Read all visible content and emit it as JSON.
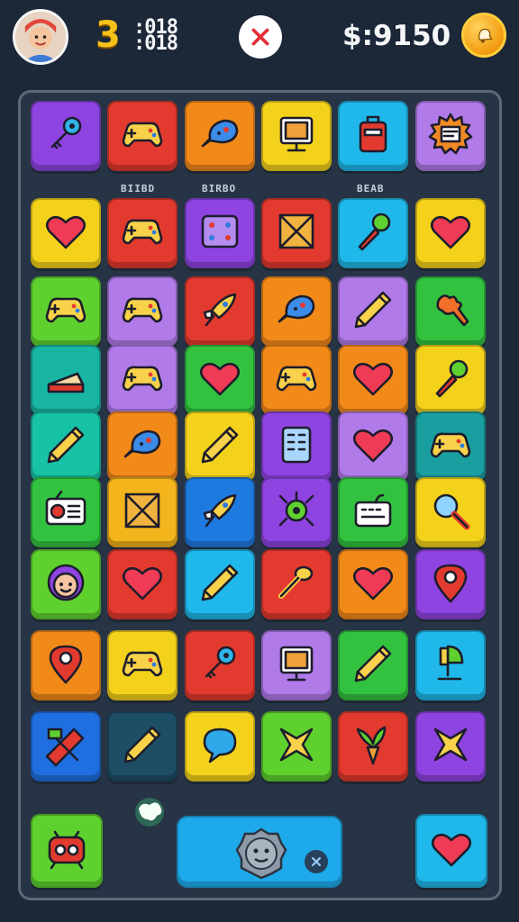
{
  "hud": {
    "level": "3",
    "score": ":018\n:018",
    "score_line1": ":018",
    "score_line2": ":018",
    "coins": "$:9150",
    "close_icon": "close-x-icon",
    "coin_icon": "coin-bell-icon"
  },
  "board": {
    "labels": [
      "BIIBD",
      "BIRBO",
      "BEAB"
    ],
    "rows": [
      [
        {
          "icon": "key-icon",
          "color": "#8e44e0"
        },
        {
          "icon": "gamepad-icon",
          "color": "#e33a2f"
        },
        {
          "icon": "fish-icon",
          "color": "#f28a1a"
        },
        {
          "icon": "monitor-icon",
          "color": "#f4d21c"
        },
        {
          "icon": "luggage-icon",
          "color": "#20b8ea"
        },
        {
          "icon": "sun-card-icon",
          "color": "#b07ae8"
        }
      ],
      [
        {
          "icon": "heart-icon",
          "color": "#f4d21c"
        },
        {
          "icon": "gamepad-icon",
          "color": "#e33a2f"
        },
        {
          "icon": "dice-icon",
          "color": "#8e44e0"
        },
        {
          "icon": "crate-icon",
          "color": "#e33a2f"
        },
        {
          "icon": "microphone-icon",
          "color": "#20b8ea"
        },
        {
          "icon": "heart-icon",
          "color": "#f4d21c"
        }
      ],
      [
        {
          "icon": "gamepad-icon",
          "color": "#5fd12f"
        },
        {
          "icon": "gamepad-icon",
          "color": "#b07ae8"
        },
        {
          "icon": "rocket-icon",
          "color": "#e33a2f"
        },
        {
          "icon": "fish-icon",
          "color": "#f28a1a"
        },
        {
          "icon": "pencil-icon",
          "color": "#b07ae8"
        },
        {
          "icon": "paint-splat-icon",
          "color": "#33c240"
        }
      ],
      [
        {
          "icon": "cake-slice-icon",
          "color": "#18b5a3"
        },
        {
          "icon": "gamepad-icon",
          "color": "#b07ae8"
        },
        {
          "icon": "heart-icon",
          "color": "#33c240"
        },
        {
          "icon": "gamepad-icon",
          "color": "#f28a1a"
        },
        {
          "icon": "heart-icon",
          "color": "#f28a1a"
        },
        {
          "icon": "microphone-icon",
          "color": "#f4d21c"
        }
      ],
      [
        {
          "icon": "pencil-icon",
          "color": "#18c3a5"
        },
        {
          "icon": "fish-icon",
          "color": "#f28a1a"
        },
        {
          "icon": "pencil-icon",
          "color": "#f4d21c"
        },
        {
          "icon": "calculator-icon",
          "color": "#8e44e0"
        },
        {
          "icon": "heart-icon",
          "color": "#b07ae8"
        },
        {
          "icon": "gamepad-icon",
          "color": "#1a9fa0"
        }
      ],
      [
        {
          "icon": "radio-icon",
          "color": "#33c240"
        },
        {
          "icon": "crate-icon",
          "color": "#f4b41c"
        },
        {
          "icon": "rocket-icon",
          "color": "#1f7ae0"
        },
        {
          "icon": "bug-icon",
          "color": "#8e44e0"
        },
        {
          "icon": "keyboard-icon",
          "color": "#33c240"
        },
        {
          "icon": "magnifier-icon",
          "color": "#f4d21c"
        }
      ],
      [
        {
          "icon": "face-icon",
          "color": "#5fd12f"
        },
        {
          "icon": "heart-icon",
          "color": "#e33a2f"
        },
        {
          "icon": "pencil-icon",
          "color": "#20b8ea"
        },
        {
          "icon": "spoon-icon",
          "color": "#e33a2f"
        },
        {
          "icon": "heart-icon",
          "color": "#f28a1a"
        },
        {
          "icon": "map-pin-icon",
          "color": "#8e44e0"
        }
      ],
      [
        {
          "icon": "map-pin-icon",
          "color": "#f28a1a"
        },
        {
          "icon": "gamepad-icon",
          "color": "#f4d21c"
        },
        {
          "icon": "key-icon",
          "color": "#e33a2f"
        },
        {
          "icon": "monitor-icon",
          "color": "#b07ae8"
        },
        {
          "icon": "pencil-icon",
          "color": "#33c240"
        },
        {
          "icon": "lamp-icon",
          "color": "#20b8ea"
        }
      ],
      [
        {
          "icon": "ruler-icon",
          "color": "#1f6fe0"
        },
        {
          "icon": "pencil-icon",
          "color": "#1e4d66"
        },
        {
          "icon": "speech-bubble-icon",
          "color": "#f4d21c"
        },
        {
          "icon": "star-cross-icon",
          "color": "#5fd12f"
        },
        {
          "icon": "plant-icon",
          "color": "#e33a2f"
        },
        {
          "icon": "star-cross-icon",
          "color": "#8e44e0"
        }
      ]
    ]
  },
  "bottom": {
    "left_tile": {
      "icon": "robot-icon",
      "color": "#5fd12f"
    },
    "panel_icon": "stone-face-icon",
    "panel_close_icon": "close-x-icon",
    "right_tile": {
      "icon": "heart-icon",
      "color": "#20b8ea"
    },
    "cursor_icon": "glowing-hand-icon"
  }
}
